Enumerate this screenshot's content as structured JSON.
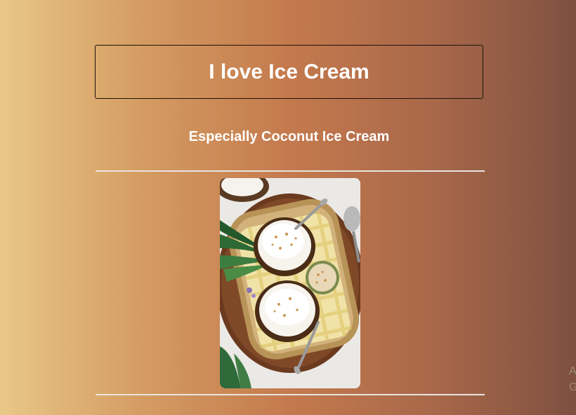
{
  "page": {
    "title": "I love Ice Cream",
    "subtitle": "Especially Coconut Ice Cream"
  },
  "image": {
    "alt": "Two coconut shells filled with coconut ice cream on a wooden tray",
    "icon": "coconut-ice-cream-photo"
  },
  "watermark": {
    "line1": "A",
    "line2": "G"
  },
  "colors": {
    "gradient_start": "#e9c887",
    "gradient_mid": "#c47a4d",
    "gradient_end": "#7e5040",
    "text": "#ffffff",
    "border": "#1e1209"
  }
}
